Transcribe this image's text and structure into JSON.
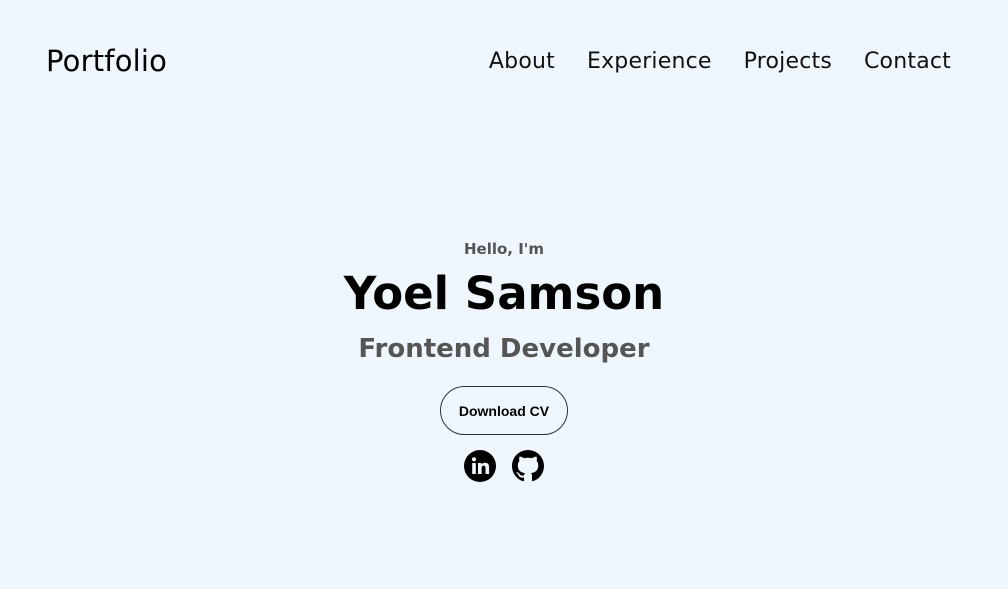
{
  "header": {
    "logo": "Portfolio",
    "nav": [
      {
        "label": "About"
      },
      {
        "label": "Experience"
      },
      {
        "label": "Projects"
      },
      {
        "label": "Contact"
      }
    ]
  },
  "hero": {
    "greeting": "Hello, I'm",
    "name": "Yoel Samson",
    "role": "Frontend Developer",
    "cv_button": "Download CV",
    "socials": [
      {
        "icon": "linkedin-icon"
      },
      {
        "icon": "github-icon"
      }
    ]
  },
  "colors": {
    "background": "#eff6fe",
    "text": "#000000",
    "muted": "#555555"
  }
}
